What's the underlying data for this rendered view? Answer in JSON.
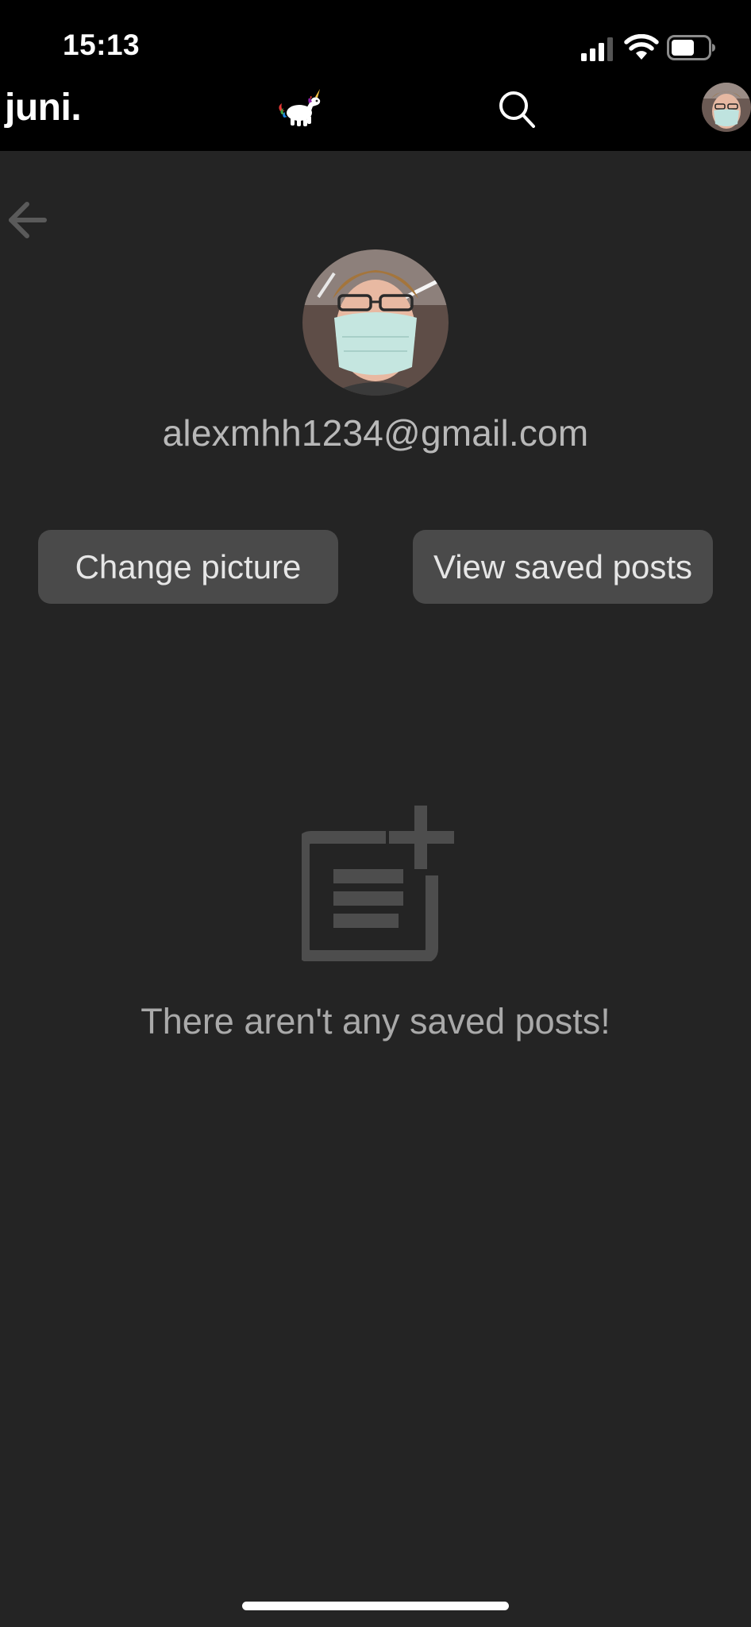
{
  "status_bar": {
    "time": "15:13",
    "icons": [
      "signal-icon",
      "wifi-icon",
      "battery-icon"
    ]
  },
  "header": {
    "brand": "juni.",
    "icons": [
      "unicorn-icon",
      "search-icon",
      "avatar"
    ]
  },
  "profile": {
    "email": "alexmhh1234@gmail.com"
  },
  "actions": {
    "change_picture_label": "Change picture",
    "view_saved_label": "View saved posts"
  },
  "empty_state": {
    "icon": "add-post-icon",
    "message": "There aren't any saved posts!"
  },
  "colors": {
    "background": "#242424",
    "header": "#000000",
    "button": "#4a4a4a",
    "text_muted": "#b8b8b8"
  }
}
